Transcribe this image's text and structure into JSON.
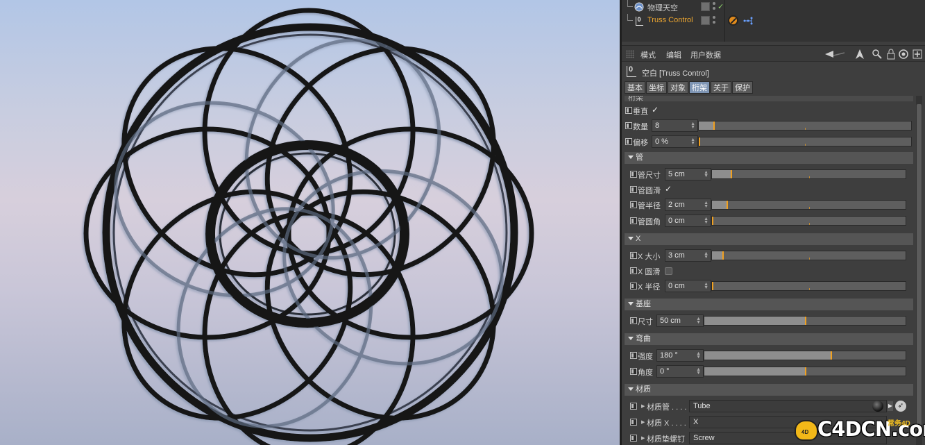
{
  "object_manager": {
    "rows": [
      {
        "label": "物理天空",
        "icon": "sky-icon"
      },
      {
        "label": "Truss Control",
        "icon": "null-object-icon"
      }
    ]
  },
  "attr_toolbar": {
    "menu": [
      "模式",
      "编辑",
      "用户数据"
    ]
  },
  "attr_title": {
    "icon_text": "0",
    "text": "空白 [Truss Control]"
  },
  "tabs": [
    "基本",
    "坐标",
    "对象",
    "桁架",
    "关于",
    "保护"
  ],
  "truss": {
    "partial_header": "桁架",
    "vertical": {
      "label": "垂直",
      "checked": true
    },
    "count": {
      "label": "数量",
      "value": "8"
    },
    "offset": {
      "label": "偏移",
      "value": "0 %"
    }
  },
  "tube_group": {
    "title": "管",
    "size": {
      "label": "管尺寸",
      "value": "5 cm"
    },
    "smooth": {
      "label": "管圆滑",
      "checked": true
    },
    "radius": {
      "label": "管半径",
      "value": "2 cm"
    },
    "fillet": {
      "label": "管圆角",
      "value": "0 cm"
    }
  },
  "x_group": {
    "title": "X",
    "size": {
      "label": "X 大小",
      "value": "3 cm"
    },
    "smooth": {
      "label": "X 圆滑",
      "checked": false
    },
    "radius": {
      "label": "X 半径",
      "value": "0 cm"
    }
  },
  "base_group": {
    "title": "基座",
    "size": {
      "label": "尺寸",
      "value": "50 cm"
    }
  },
  "bend_group": {
    "title": "弯曲",
    "strength": {
      "label": "强度",
      "value": "180 °"
    },
    "angle": {
      "label": "角度",
      "value": "0 °"
    }
  },
  "material_group": {
    "title": "材质",
    "tube": {
      "label": "材质管 . . . .",
      "value": "Tube"
    },
    "x": {
      "label": "材质 X . . . .",
      "value": "X"
    },
    "screw": {
      "label": "材质垫螺钉",
      "value": "Screw"
    }
  },
  "watermark": {
    "text": "C4DCN.com",
    "sub": "常务4D"
  },
  "colors": {
    "accent": "#f0a020",
    "selected_object": "#f0a830",
    "tab_active": "#7e95b4",
    "panel_bg": "#3e3e3e"
  }
}
